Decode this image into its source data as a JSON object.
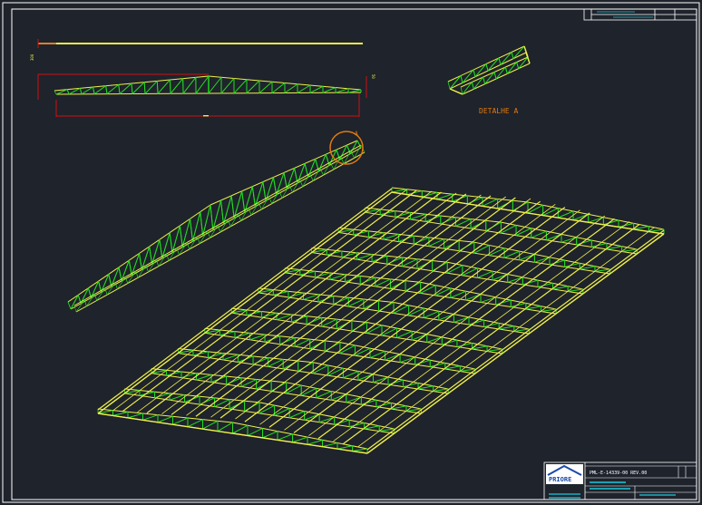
{
  "drawing": {
    "detail_label": "DETALHE A",
    "callout_letter": "A",
    "elevation_span_text": "▬▬",
    "dim_left_text": "300",
    "dim_right_text": "50",
    "title_block": {
      "company": "PRIORE",
      "drawing_code": "PML-E-14339-00 REV.00"
    }
  },
  "colors": {
    "background": "#1f232b",
    "frame": "#ffffff",
    "chord": "#f0f04a",
    "web": "#22dd22",
    "dimension": "#cc1111",
    "callout": "#e07a10",
    "titleblock_accent": "#19c9e0"
  }
}
